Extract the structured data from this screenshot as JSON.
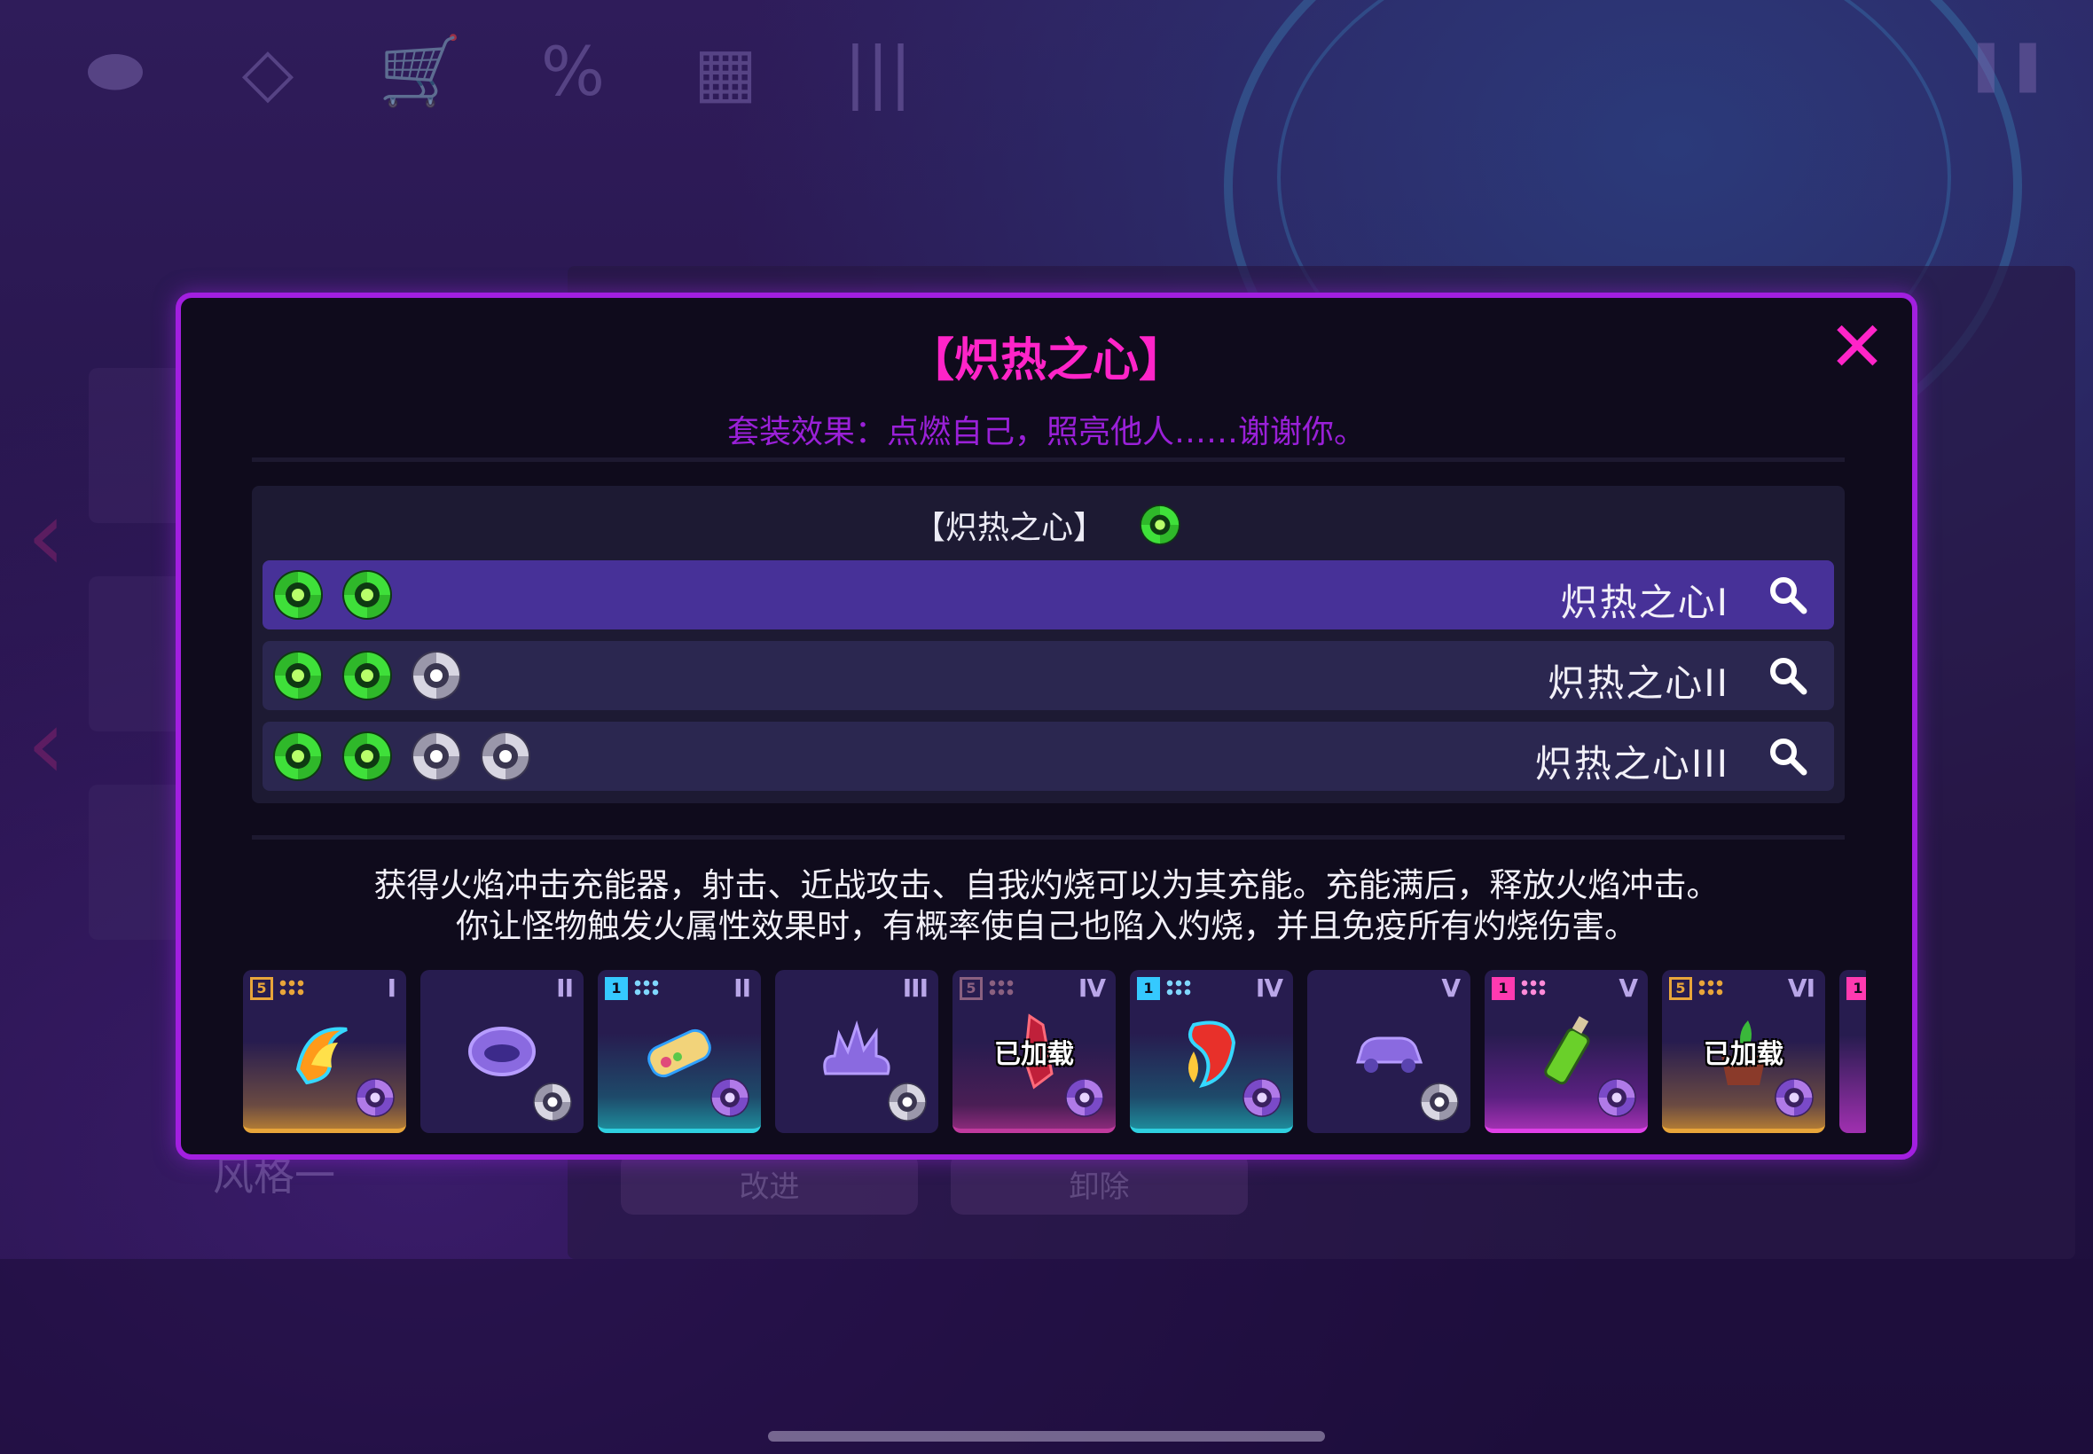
{
  "colors": {
    "accent": "#ff24c8",
    "modal_border": "#a21fe0",
    "subtitle": "#9a20d8",
    "active_row": "#473198",
    "row": "#2b2750",
    "swirl_active": "#3fe03a",
    "swirl_inactive": "#c9c6d4"
  },
  "background": {
    "top_icons": [
      "coin-stack-icon",
      "diamond-icon",
      "cart-icon",
      "percent-icon",
      "clipboard-icon",
      "waveform-icon"
    ],
    "top_icon_glyphs": [
      "⬬",
      "◇",
      "🛒",
      "%",
      "▦",
      "|||"
    ],
    "pause_glyph": "❚❚",
    "style_label": "风格一",
    "button_improve": "改进",
    "button_unload": "卸除"
  },
  "modal": {
    "title": "【炽热之心】",
    "close_glyph": "✕",
    "subtitle": "套装效果：点燃自己，照亮他人……谢谢你。",
    "set_header": "【炽热之心】",
    "tiers": [
      {
        "name": "炽热之心I",
        "active_count": 2,
        "inactive_count": 0,
        "selected": true
      },
      {
        "name": "炽热之心II",
        "active_count": 2,
        "inactive_count": 1,
        "selected": false
      },
      {
        "name": "炽热之心III",
        "active_count": 2,
        "inactive_count": 2,
        "selected": false
      }
    ],
    "description_line1": "获得火焰冲击充能器，射击、近战攻击、自我灼烧可以为其充能。充能满后，释放火焰冲击。",
    "description_line2": "你让怪物触发火属性效果时，有概率使自己也陷入灼烧，并且免疫所有灼烧伤害。",
    "items": [
      {
        "tier": "I",
        "badge": "5",
        "rarity": "gold",
        "icon": "flame-claw-icon",
        "loaded": ""
      },
      {
        "tier": "II",
        "badge": "",
        "rarity": "none",
        "icon": "lips-icon",
        "loaded": ""
      },
      {
        "tier": "II",
        "badge": "1",
        "rarity": "teal",
        "icon": "burrito-icon",
        "loaded": ""
      },
      {
        "tier": "III",
        "badge": "",
        "rarity": "none",
        "icon": "splash-icon",
        "loaded": ""
      },
      {
        "tier": "IV",
        "badge": "5",
        "rarity": "pink",
        "icon": "red-blade-icon",
        "loaded": "已加载"
      },
      {
        "tier": "IV",
        "badge": "1",
        "rarity": "teal",
        "icon": "chili-pepper-icon",
        "loaded": ""
      },
      {
        "tier": "V",
        "badge": "",
        "rarity": "none",
        "icon": "car-icon",
        "loaded": ""
      },
      {
        "tier": "V",
        "badge": "1",
        "rarity": "magenta",
        "icon": "bottle-icon",
        "loaded": ""
      },
      {
        "tier": "VI",
        "badge": "5",
        "rarity": "gold",
        "icon": "sprout-pot-icon",
        "loaded": "已加载"
      }
    ]
  }
}
